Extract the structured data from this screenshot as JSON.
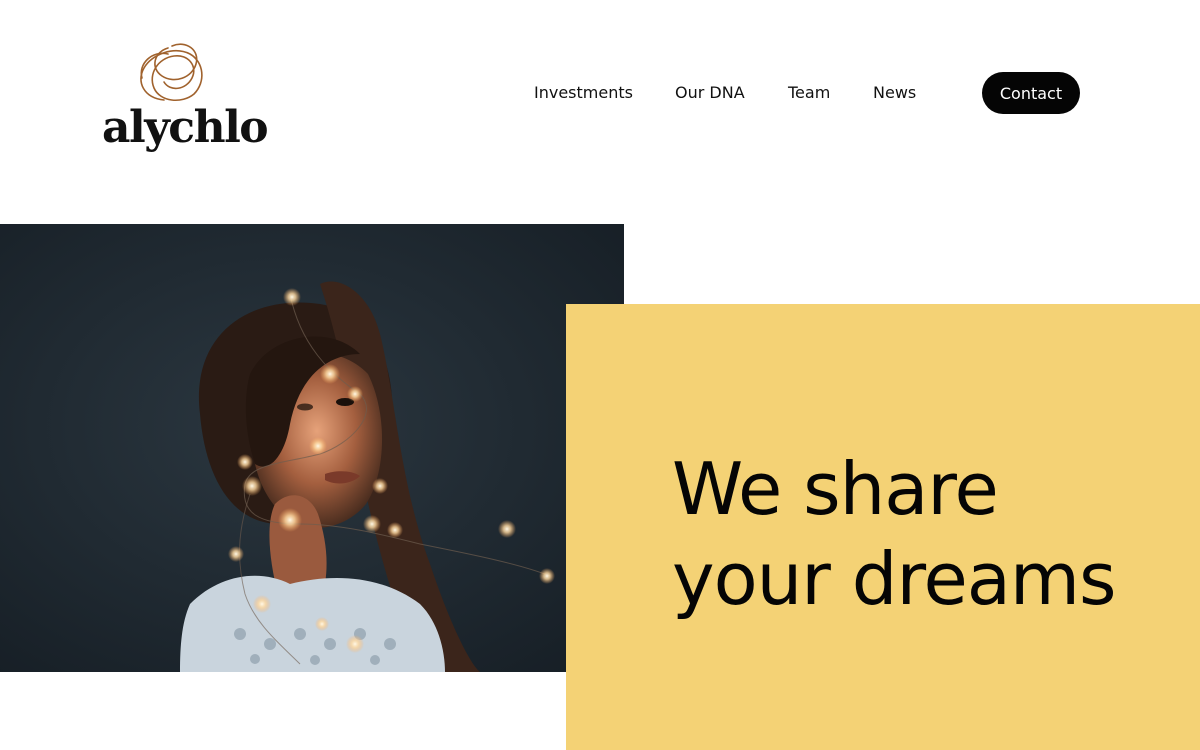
{
  "brand": {
    "name": "alychlo",
    "logo_icon": "scribble-loop-icon",
    "logo_color": "#a0622d"
  },
  "nav": {
    "items": [
      {
        "label": "Investments"
      },
      {
        "label": "Our DNA"
      },
      {
        "label": "Team"
      },
      {
        "label": "News"
      }
    ],
    "contact_label": "Contact"
  },
  "hero": {
    "headline_line1": "We share",
    "headline_line2": "your dreams",
    "panel_color": "#f4d275",
    "photo_icon": "woman-with-fairy-lights-photo"
  },
  "colors": {
    "accent": "#f4d275",
    "button_bg": "#050505",
    "text": "#111111"
  }
}
